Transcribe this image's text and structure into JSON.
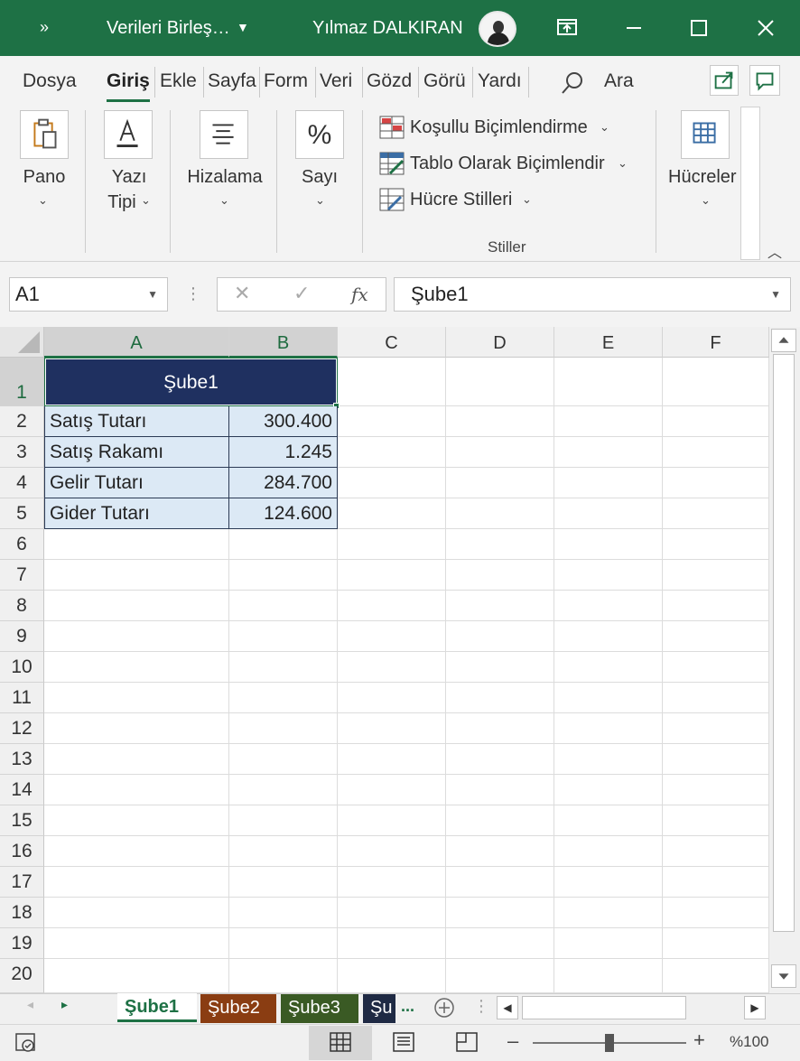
{
  "titlebar": {
    "quick_access": "»",
    "document": "Verileri Birleş…",
    "user": "Yılmaz DALKIRAN"
  },
  "ribbon_tabs": [
    "Dosya",
    "Giriş",
    "Ekle",
    "Sayfa",
    "Form",
    "Veri",
    "Gözd",
    "Görü",
    "Yardı"
  ],
  "search_label": "Ara",
  "ribbon": {
    "pano": "Pano",
    "yazi_line1": "Yazı",
    "yazi_line2": "Tipi",
    "hizalama": "Hizalama",
    "sayi": "Sayı",
    "sayi_glyph": "%",
    "kosullu": "Koşullu Biçimlendirme",
    "tablo": "Tablo Olarak Biçimlendir",
    "hucre_stilleri": "Hücre Stilleri",
    "stiller": "Stiller",
    "hucreler": "Hücreler"
  },
  "formula_bar": {
    "name_box": "A1",
    "formula": "Şube1"
  },
  "columns": [
    "A",
    "B",
    "C",
    "D",
    "E",
    "F"
  ],
  "rows": [
    "1",
    "2",
    "3",
    "4",
    "5",
    "6",
    "7",
    "8",
    "9",
    "10",
    "11",
    "12",
    "13",
    "14",
    "15",
    "16",
    "17",
    "18",
    "19",
    "20"
  ],
  "table": {
    "header": "Şube1",
    "items": [
      {
        "label": "Satış Tutarı",
        "value": "300.400"
      },
      {
        "label": "Satış Rakamı",
        "value": "1.245"
      },
      {
        "label": "Gelir Tutarı",
        "value": "284.700"
      },
      {
        "label": "Gider Tutarı",
        "value": "124.600"
      }
    ]
  },
  "sheets": [
    {
      "name": "Şube1",
      "color": "#ffffff",
      "active": true
    },
    {
      "name": "Şube2",
      "color": "#8a3d12",
      "active": false
    },
    {
      "name": "Şube3",
      "color": "#3a5a24",
      "active": false
    },
    {
      "name": "Şu",
      "color": "#1f2a44",
      "active": false
    }
  ],
  "sheet_overflow": "...",
  "zoom": "%100",
  "colors": {
    "accent": "#1e7145",
    "table_header_bg": "#1f3060",
    "table_body_bg": "#dce9f5"
  }
}
